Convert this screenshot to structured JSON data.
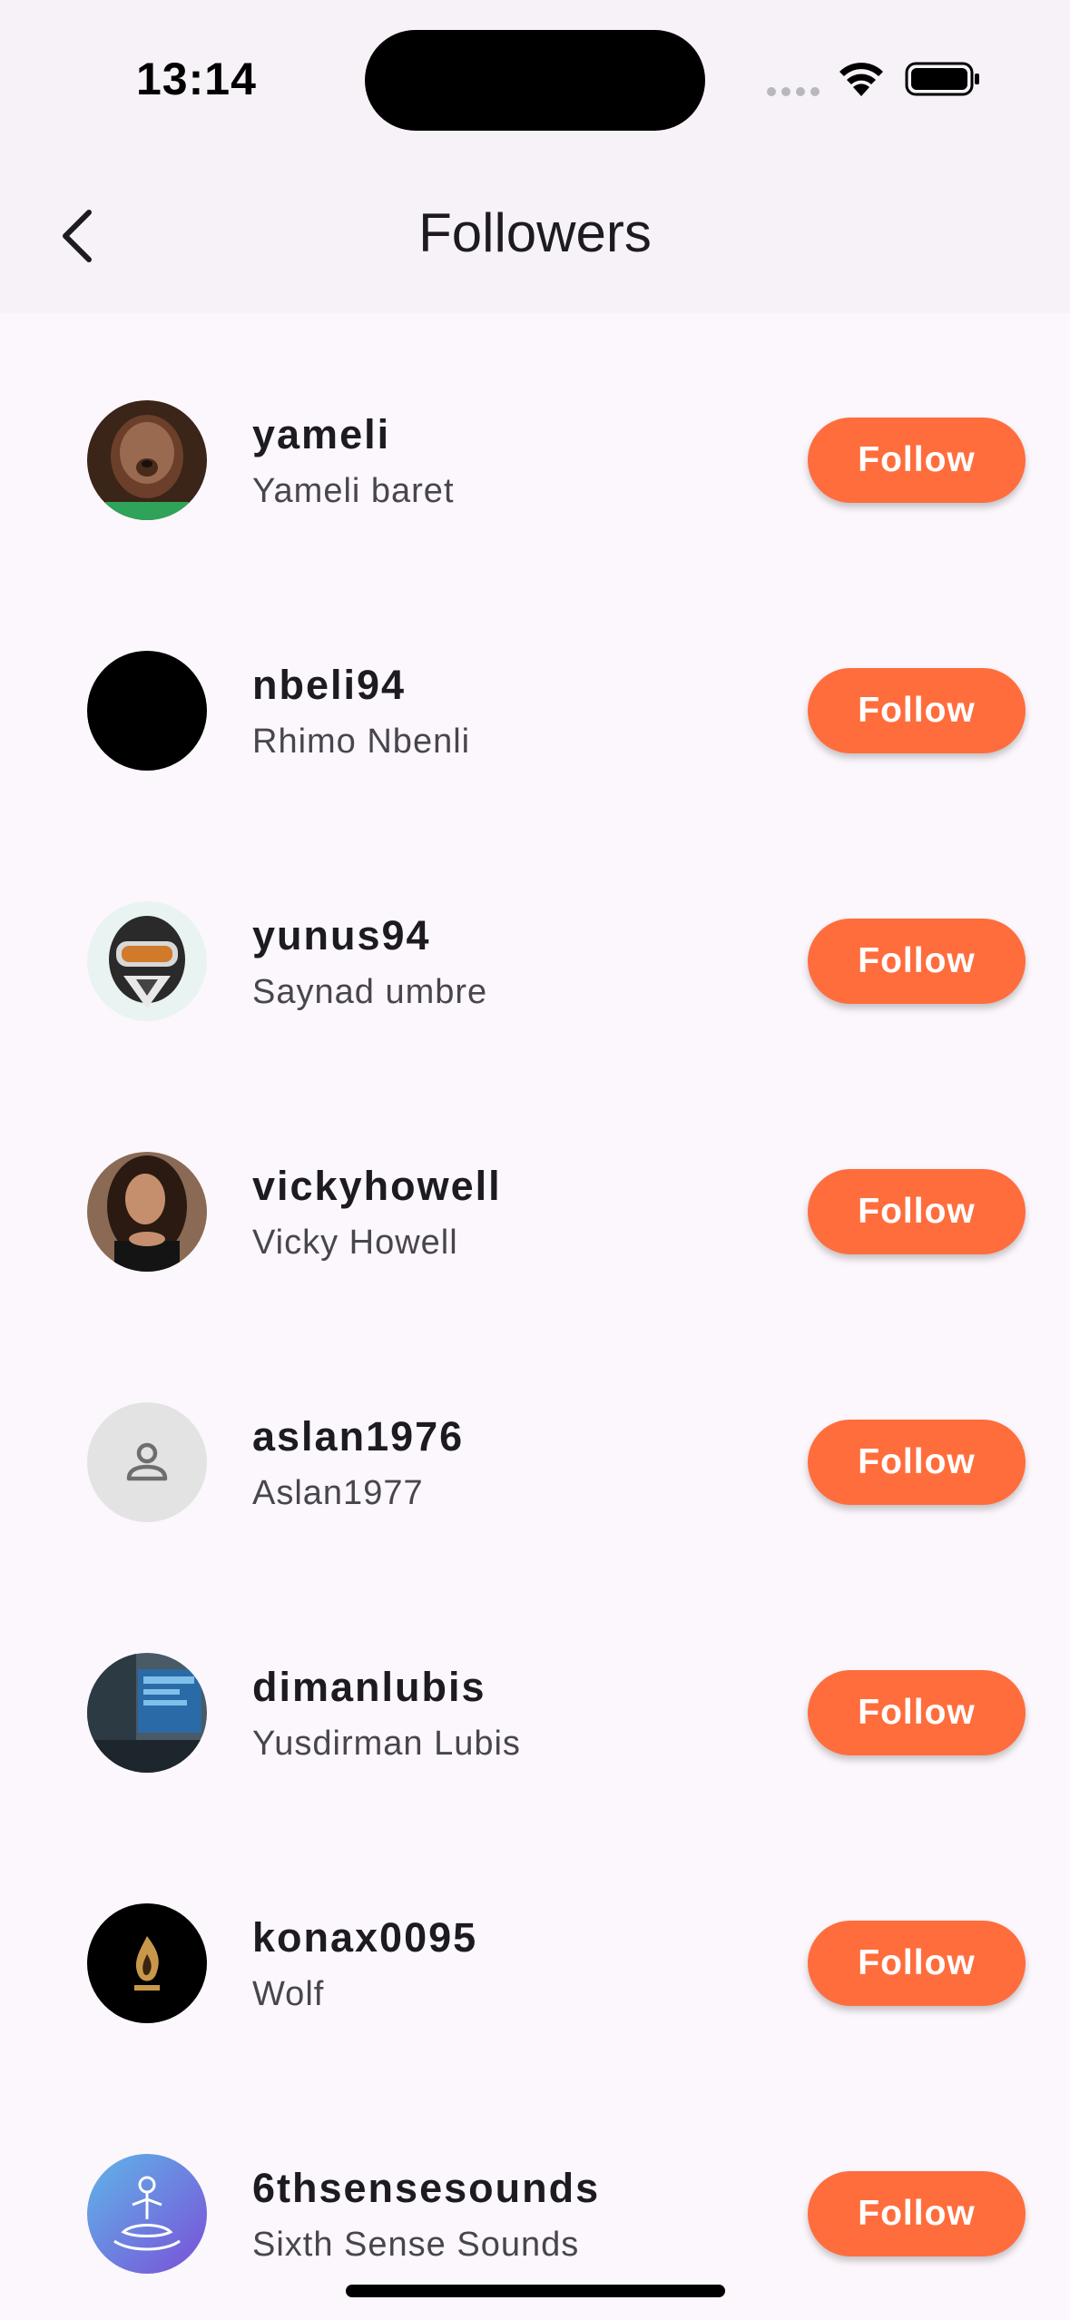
{
  "status_bar": {
    "time": "13:14"
  },
  "header": {
    "title": "Followers",
    "back_icon": "chevron-left-icon"
  },
  "followers": [
    {
      "username": "yameli",
      "display_name": "Yameli baret",
      "follow_label": "Follow"
    },
    {
      "username": "nbeli94",
      "display_name": "Rhimo Nbenli",
      "follow_label": "Follow"
    },
    {
      "username": "yunus94",
      "display_name": "Saynad umbre",
      "follow_label": "Follow"
    },
    {
      "username": "vickyhowell",
      "display_name": "Vicky Howell",
      "follow_label": "Follow"
    },
    {
      "username": "aslan1976",
      "display_name": "Aslan1977",
      "follow_label": "Follow"
    },
    {
      "username": "dimanlubis",
      "display_name": "Yusdirman Lubis",
      "follow_label": "Follow"
    },
    {
      "username": "konax0095",
      "display_name": "Wolf",
      "follow_label": "Follow"
    },
    {
      "username": "6thsensesounds",
      "display_name": "Sixth Sense Sounds",
      "follow_label": "Follow"
    }
  ],
  "colors": {
    "accent": "#ff6d3d",
    "background": "#fcf7fc",
    "header_background": "#f7f2f7"
  }
}
